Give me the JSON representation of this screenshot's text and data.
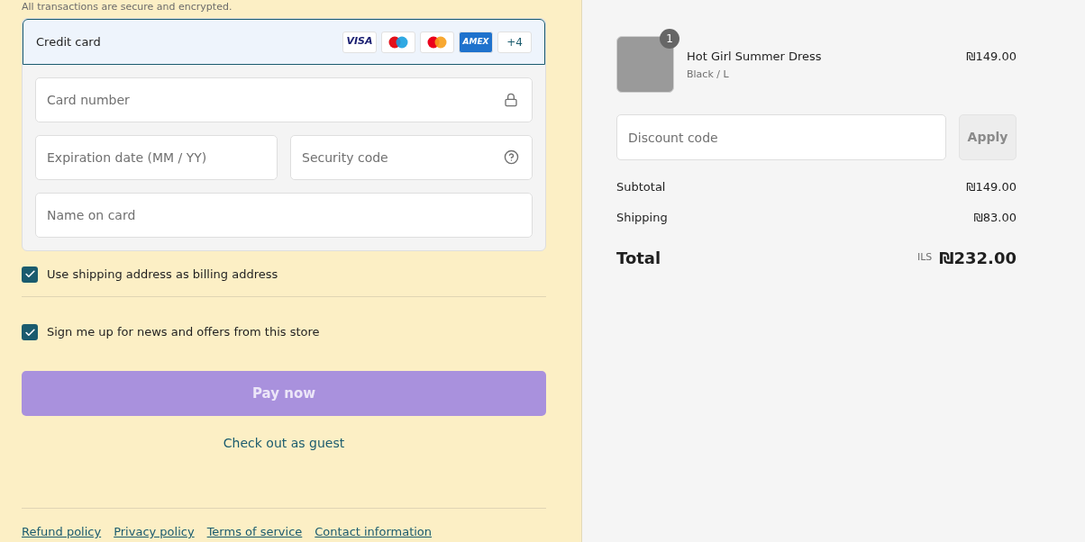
{
  "secure_note": "All transactions are secure and encrypted.",
  "payment": {
    "method": "Credit card",
    "selected": true,
    "cards": [
      {
        "kind": "visa",
        "label": "VISA"
      },
      {
        "kind": "maestro"
      },
      {
        "kind": "mastercard"
      },
      {
        "kind": "amex",
        "label": "AMEX"
      },
      {
        "kind": "more",
        "label": "+4"
      }
    ],
    "fields": {
      "card_number": {
        "placeholder": "Card number"
      },
      "expiration": {
        "placeholder": "Expiration date (MM / YY)"
      },
      "security_code": {
        "placeholder": "Security code"
      },
      "name_on_card": {
        "placeholder": "Name on card"
      }
    }
  },
  "options": [
    {
      "label": "Use shipping address as billing address",
      "checked": true
    },
    {
      "label": "Sign me up for news and offers from this store",
      "checked": true
    }
  ],
  "pay_button": "Pay now",
  "guest_link": "Check out as guest",
  "footer_links": [
    "Refund policy",
    "Privacy policy",
    "Terms of service",
    "Contact information"
  ],
  "order": {
    "items": [
      {
        "name": "Hot Girl Summer Dress",
        "variant": "Black / L",
        "quantity": "1",
        "price": "₪149.00"
      }
    ],
    "discount": {
      "placeholder": "Discount code",
      "button": "Apply"
    },
    "lines": [
      {
        "label": "Subtotal",
        "value": "₪149.00"
      },
      {
        "label": "Shipping",
        "value": "₪83.00"
      }
    ],
    "total": {
      "label": "Total",
      "currency": "ILS",
      "value": "₪232.00"
    }
  }
}
